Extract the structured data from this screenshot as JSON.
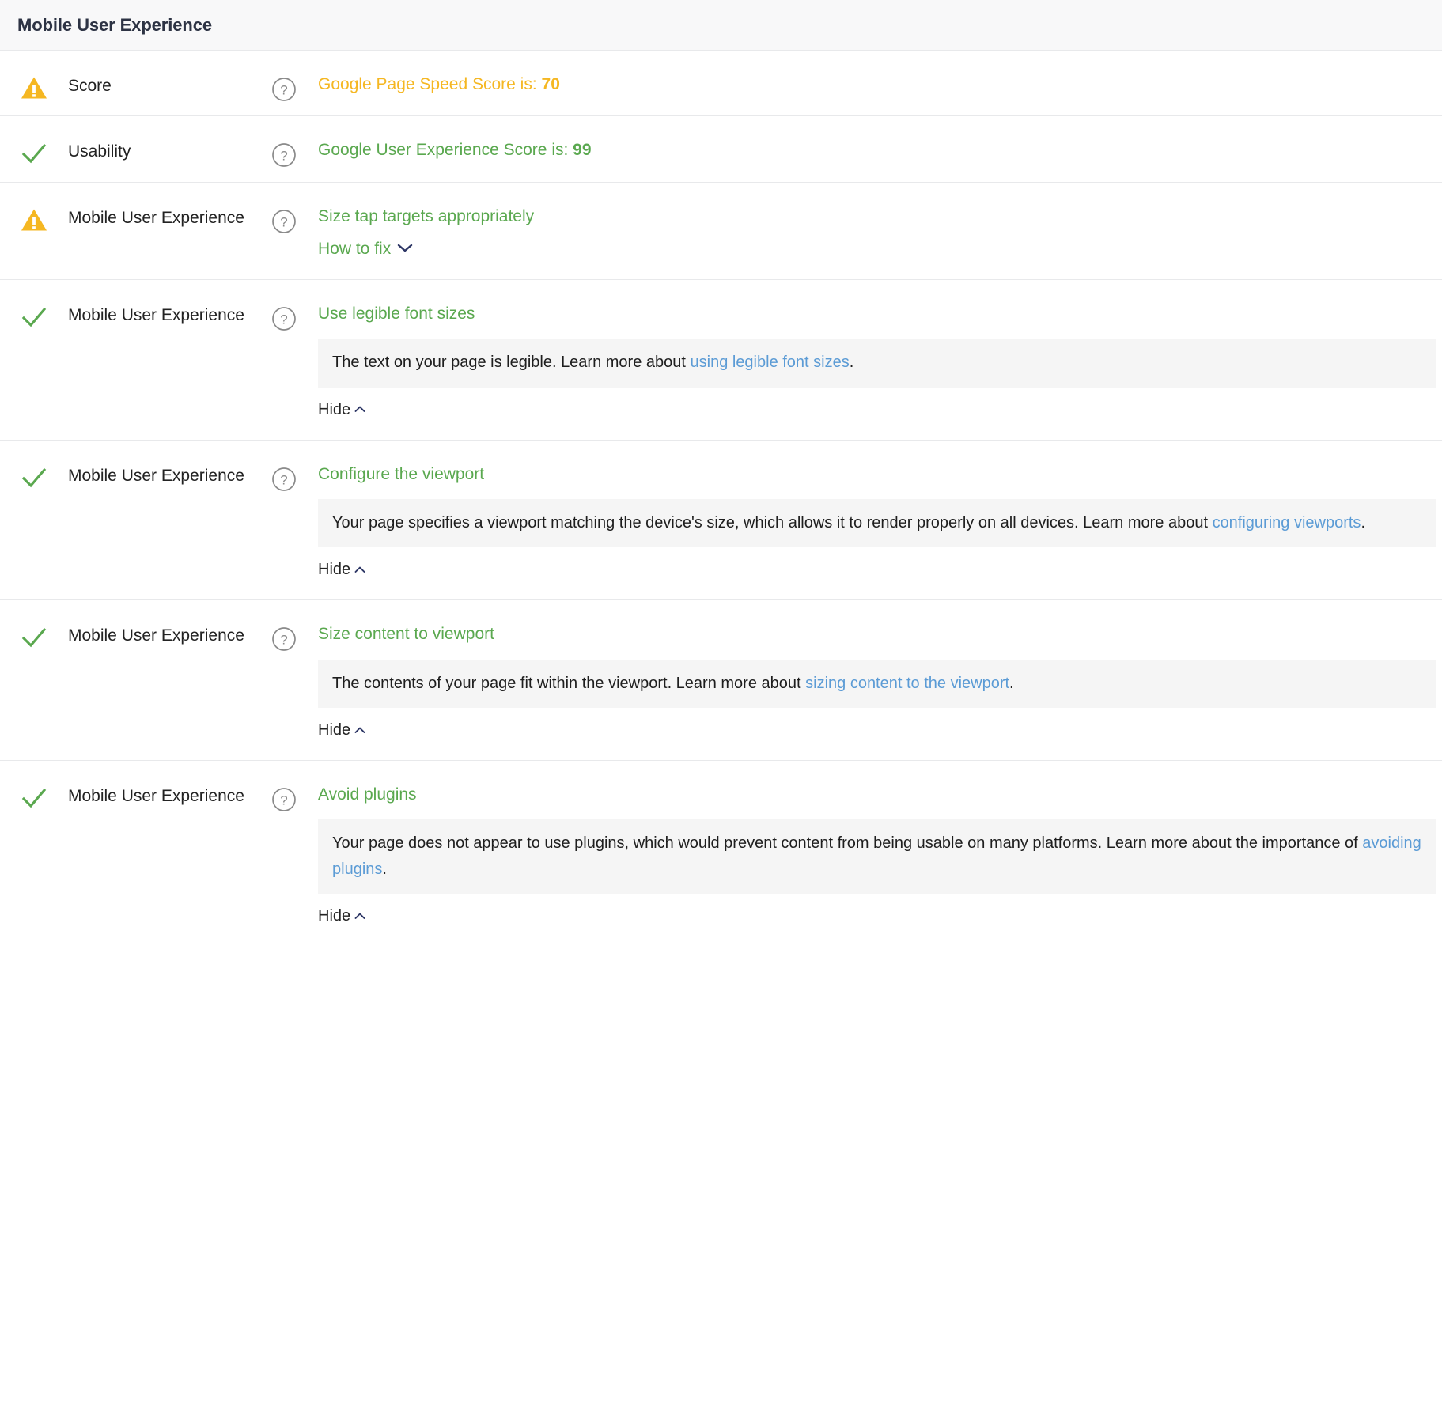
{
  "header": {
    "title": "Mobile User Experience"
  },
  "colors": {
    "warning": "#f5b722",
    "success": "#5aa84f",
    "link": "#5b9bd5",
    "chevron": "#2d3665",
    "help_icon": "#8a8a8a",
    "header_bg": "#f8f8f9",
    "box_bg": "#f5f5f5",
    "divider": "#e8e9eb"
  },
  "icons": {
    "warning": "warning-triangle-icon",
    "success": "check-icon",
    "help": "help-circle-icon",
    "chevron_down": "chevron-down-icon",
    "chevron_up": "chevron-up-icon"
  },
  "labels": {
    "how_to_fix": "How to fix",
    "hide": "Hide"
  },
  "rows": [
    {
      "status": "warning",
      "label": "Score",
      "headline_prefix": "Google Page Speed Score is: ",
      "headline_value": "70",
      "headline_state": "warn",
      "has_description": false,
      "has_how_to_fix": false,
      "has_hide": false
    },
    {
      "status": "success",
      "label": "Usability",
      "headline_prefix": "Google User Experience Score is: ",
      "headline_value": "99",
      "headline_state": "ok",
      "has_description": false,
      "has_how_to_fix": false,
      "has_hide": false
    },
    {
      "status": "warning",
      "label": "Mobile User Experience",
      "headline": "Size tap targets appropriately",
      "headline_state": "warn",
      "has_description": false,
      "has_how_to_fix": true,
      "has_hide": false
    },
    {
      "status": "success",
      "label": "Mobile User Experience",
      "headline": "Use legible font sizes",
      "headline_state": "ok",
      "has_description": true,
      "description_parts": [
        {
          "type": "text",
          "value": "The text on your page is legible. Learn more about "
        },
        {
          "type": "link",
          "value": "using legible font sizes"
        },
        {
          "type": "text",
          "value": "."
        }
      ],
      "has_how_to_fix": false,
      "has_hide": true
    },
    {
      "status": "success",
      "label": "Mobile User Experience",
      "headline": "Configure the viewport",
      "headline_state": "ok",
      "has_description": true,
      "description_parts": [
        {
          "type": "text",
          "value": "Your page specifies a viewport matching the device's size, which allows it to render properly on all devices. Learn more about "
        },
        {
          "type": "link",
          "value": "configuring viewports"
        },
        {
          "type": "text",
          "value": "."
        }
      ],
      "has_how_to_fix": false,
      "has_hide": true
    },
    {
      "status": "success",
      "label": "Mobile User Experience",
      "headline": "Size content to viewport",
      "headline_state": "ok",
      "has_description": true,
      "description_parts": [
        {
          "type": "text",
          "value": "The contents of your page fit within the viewport. Learn more about "
        },
        {
          "type": "link",
          "value": "sizing content to the viewport"
        },
        {
          "type": "text",
          "value": "."
        }
      ],
      "has_how_to_fix": false,
      "has_hide": true
    },
    {
      "status": "success",
      "label": "Mobile User Experience",
      "headline": "Avoid plugins",
      "headline_state": "ok",
      "has_description": true,
      "description_parts": [
        {
          "type": "text",
          "value": "Your page does not appear to use plugins, which would prevent content from being usable on many platforms. Learn more about the importance of "
        },
        {
          "type": "link",
          "value": "avoiding plugins"
        },
        {
          "type": "text",
          "value": "."
        }
      ],
      "has_how_to_fix": false,
      "has_hide": true
    }
  ]
}
